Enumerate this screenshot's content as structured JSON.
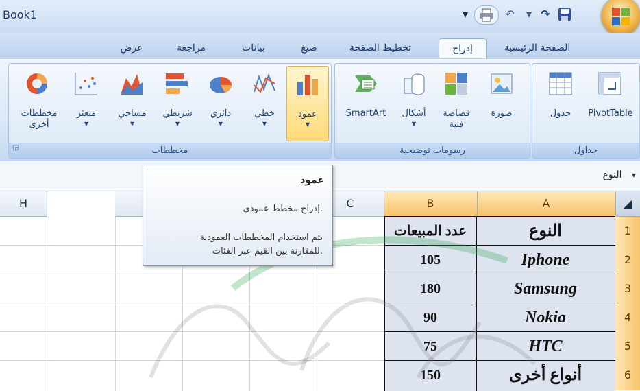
{
  "window": {
    "title": "Book1"
  },
  "quick_access": {
    "icons": [
      "print-icon",
      "undo-icon",
      "redo-icon",
      "save-icon"
    ]
  },
  "tabs": [
    {
      "label": "الصفحة الرئيسية"
    },
    {
      "label": "إدراج",
      "active": true
    },
    {
      "label": "تخطيط الصفحة"
    },
    {
      "label": "صيغ"
    },
    {
      "label": "بيانات"
    },
    {
      "label": "مراجعة"
    },
    {
      "label": "عرض"
    }
  ],
  "ribbon": {
    "groups": {
      "tables": "جداول",
      "illustrations": "رسومات توضيحية",
      "charts": "مخططات"
    },
    "buttons": {
      "pivot": "PivotTable",
      "table": "جدول",
      "picture": "صورة",
      "clipart_line1": "قصاصة",
      "clipart_line2": "فنية",
      "shapes": "أشكال",
      "smartart": "SmartArt",
      "column": "عمود",
      "line": "خطي",
      "pie": "دائري",
      "bar": "شريطي",
      "area": "مساحي",
      "scatter": "مبعثر",
      "other_line1": "مخططات",
      "other_line2": "أخرى"
    }
  },
  "formula_bar": {
    "name_box": "النوع"
  },
  "tooltip": {
    "title": "عمود",
    "line1": "إدراج مخطط عمودي.",
    "line2": "يتم استخدام المخططات العمودية",
    "line3": "للمقارنة بين القيم عبر الفئات."
  },
  "grid": {
    "columns": [
      "A",
      "B",
      "C",
      "",
      "",
      "G",
      "H"
    ],
    "rows": [
      "1",
      "2",
      "3",
      "4",
      "5",
      "6"
    ],
    "header": {
      "a": "النوع",
      "b": "عدد المبيعات"
    },
    "data": [
      {
        "a": "Iphone",
        "b": "105"
      },
      {
        "a": "Samsung",
        "b": "180"
      },
      {
        "a": "Nokia",
        "b": "90"
      },
      {
        "a": "HTC",
        "b": "75"
      },
      {
        "a": "أنواع أخرى",
        "b": "150"
      }
    ]
  },
  "colors": {
    "accent": "#f7c36a",
    "ribbon": "#d7e6f7",
    "selected_button": "#ffd978"
  }
}
